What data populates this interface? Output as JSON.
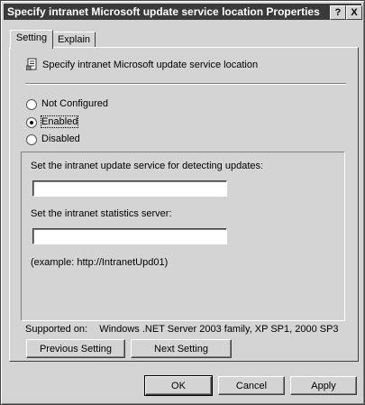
{
  "window": {
    "title": "Specify intranet Microsoft update service location Properties",
    "help_button": "?",
    "close_button": "X"
  },
  "tabs": [
    {
      "label": "Setting",
      "selected": true
    },
    {
      "label": "Explain",
      "selected": false
    }
  ],
  "policy": {
    "name": "Specify intranet Microsoft update service location",
    "icon": "policy-scroll-icon"
  },
  "state_options": [
    {
      "label": "Not Configured",
      "checked": false
    },
    {
      "label": "Enabled",
      "checked": true
    },
    {
      "label": "Disabled",
      "checked": false
    }
  ],
  "options": {
    "update_service_label": "Set the intranet update service for detecting updates:",
    "update_service_value": "",
    "statistics_server_label": "Set the intranet statistics server:",
    "statistics_server_value": "",
    "example_text": "(example: http://IntranetUpd01)"
  },
  "supported": {
    "label": "Supported on:",
    "value": "Windows .NET Server 2003 family, XP SP1, 2000 SP3"
  },
  "nav_buttons": {
    "previous": "Previous Setting",
    "next": "Next Setting"
  },
  "dialog_buttons": {
    "ok": "OK",
    "cancel": "Cancel",
    "apply": "Apply"
  }
}
